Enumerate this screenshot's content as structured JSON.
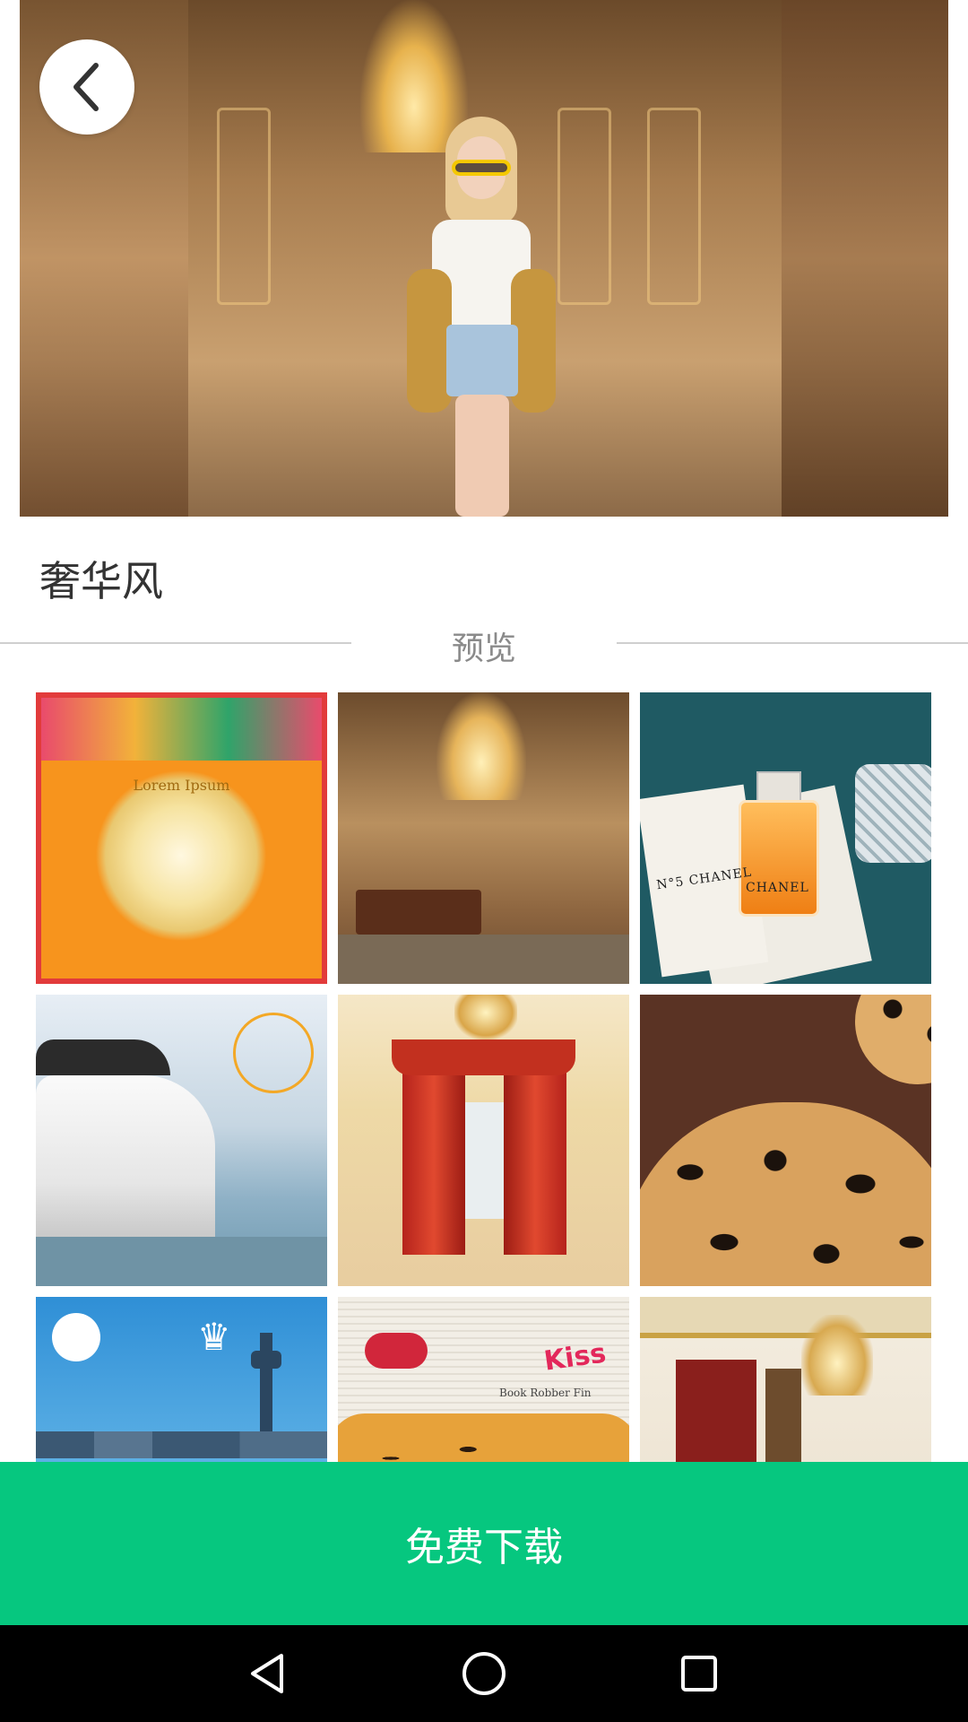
{
  "header": {
    "title": "奢华风"
  },
  "preview": {
    "label": "预览"
  },
  "tiles": [
    {
      "name": "mandala-thumb",
      "text": "Lorem Ipsum"
    },
    {
      "name": "palace-room-thumb"
    },
    {
      "name": "perfume-thumb",
      "brand_box": "N°5 CHANEL",
      "brand_bottle": "CHANEL"
    },
    {
      "name": "yacht-thumb"
    },
    {
      "name": "curtain-hall-thumb"
    },
    {
      "name": "leopard-thumb"
    },
    {
      "name": "city-tower-thumb"
    },
    {
      "name": "newspaper-thumb",
      "sticker": "Kiss",
      "print": "Book Robber Fin"
    },
    {
      "name": "gold-room-thumb"
    }
  ],
  "cta": {
    "label": "免费下载"
  },
  "colors": {
    "accent": "#06c77f",
    "title_text": "#333333",
    "muted_text": "#8a8a8a"
  },
  "icons": {
    "back": "chevron-left-icon",
    "nav_back": "triangle-back-icon",
    "nav_home": "circle-home-icon",
    "nav_recent": "square-recent-icon"
  }
}
